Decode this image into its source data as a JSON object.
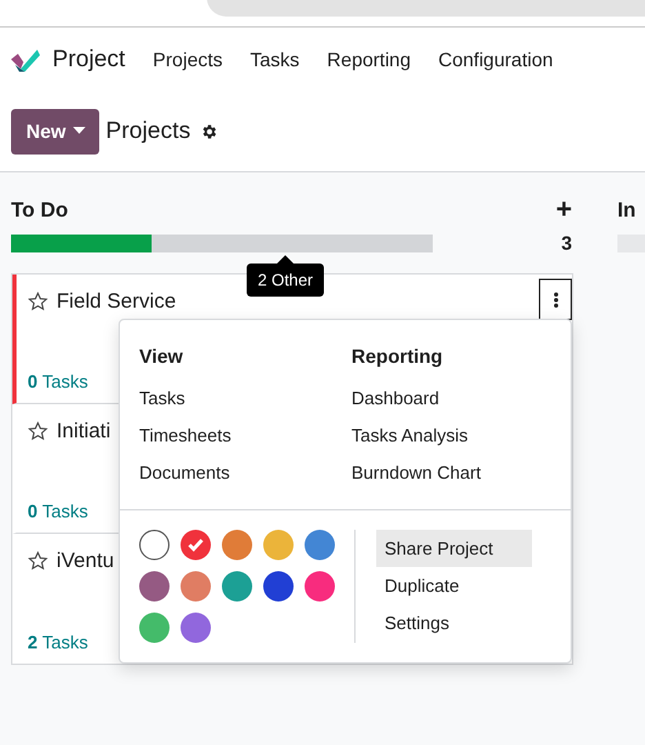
{
  "navbar": {
    "app_name": "Project",
    "menu": [
      "Projects",
      "Tasks",
      "Reporting",
      "Configuration"
    ]
  },
  "control_panel": {
    "new_button": "New",
    "breadcrumb": "Projects"
  },
  "columns": [
    {
      "title": "To Do",
      "add": "+",
      "count": "3",
      "level": 0.333,
      "tooltip": "2 Other",
      "cards": [
        {
          "name": "Field Service",
          "tasks_count": "0",
          "tasks_label": "Tasks",
          "color": "#f0323c",
          "starred": false
        },
        {
          "name": "Initiati",
          "tasks_count": "0",
          "tasks_label": "Tasks",
          "starred": false
        },
        {
          "name": "iVentu",
          "tasks_count": "2",
          "tasks_label": "Tasks",
          "starred": false
        }
      ]
    },
    {
      "title": "In",
      "level": 0
    }
  ],
  "dropdown": {
    "sections": [
      {
        "title": "View",
        "items": [
          "Tasks",
          "Timesheets",
          "Documents"
        ]
      },
      {
        "title": "Reporting",
        "items": [
          "Dashboard",
          "Tasks Analysis",
          "Burndown Chart"
        ]
      }
    ],
    "colors": [
      {
        "color": "#ffffff",
        "selected": false
      },
      {
        "color": "#f0323c",
        "selected": true
      },
      {
        "color": "#e07c38",
        "selected": false
      },
      {
        "color": "#ebb43a",
        "selected": false
      },
      {
        "color": "#4386d4",
        "selected": false
      },
      {
        "color": "#955a83",
        "selected": false
      },
      {
        "color": "#e07d63",
        "selected": false
      },
      {
        "color": "#1ca095",
        "selected": false
      },
      {
        "color": "#213fd4",
        "selected": false
      },
      {
        "color": "#f82c7e",
        "selected": false
      },
      {
        "color": "#44bb6a",
        "selected": false
      },
      {
        "color": "#9167dd",
        "selected": false
      }
    ],
    "actions": [
      {
        "label": "Share Project",
        "selected": true
      },
      {
        "label": "Duplicate",
        "selected": false
      },
      {
        "label": "Settings",
        "selected": false
      }
    ]
  }
}
